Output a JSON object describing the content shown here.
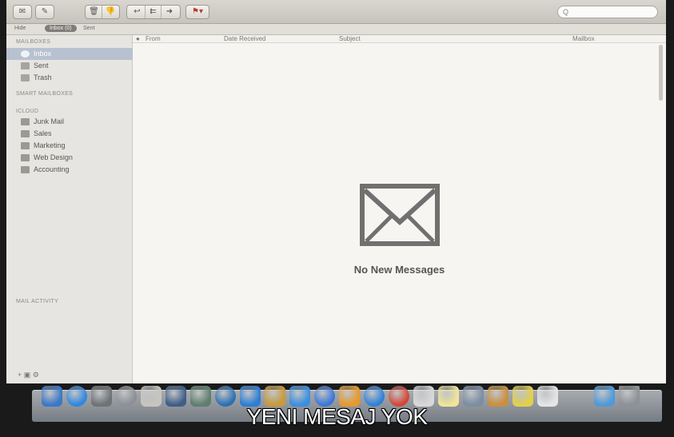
{
  "favorites": {
    "hide": "Hide",
    "inbox": "Inbox (0)",
    "sent": "Sent"
  },
  "search": {
    "placeholder": "Q"
  },
  "sidebar": {
    "mailboxes_header": "MAILBOXES",
    "mailboxes": [
      {
        "label": "Inbox",
        "icon": "inbox-icon"
      },
      {
        "label": "Sent",
        "icon": "sent-icon"
      },
      {
        "label": "Trash",
        "icon": "trash-icon"
      }
    ],
    "smart_header": "SMART MAILBOXES",
    "icloud_header": "ICLOUD",
    "icloud": [
      {
        "label": "Junk Mail",
        "icon": "folder-icon"
      },
      {
        "label": "Sales",
        "icon": "folder-icon"
      },
      {
        "label": "Marketing",
        "icon": "folder-icon"
      },
      {
        "label": "Web Design",
        "icon": "folder-icon"
      },
      {
        "label": "Accounting",
        "icon": "folder-icon"
      }
    ],
    "activity_header": "MAIL ACTIVITY",
    "bottom_controls": "+  ▣  ⚙"
  },
  "list_columns": {
    "dot": "●",
    "from": "From",
    "date": "Date Received",
    "subject": "Subject",
    "mailbox": "Mailbox"
  },
  "empty_state": {
    "message": "No New Messages",
    "icon": "envelope-icon"
  },
  "dock": {
    "icons": [
      {
        "name": "finder-icon",
        "color": "#3b78c8"
      },
      {
        "name": "app-store-icon",
        "color": "#2f86e0"
      },
      {
        "name": "photo-booth-icon",
        "color": "#6f7376"
      },
      {
        "name": "launchpad-icon",
        "color": "#8c8f93"
      },
      {
        "name": "calculator-icon",
        "color": "#c7c5be"
      },
      {
        "name": "facetime-icon",
        "color": "#3f5f87"
      },
      {
        "name": "image-capture-icon",
        "color": "#5f7f6e"
      },
      {
        "name": "quicktime-icon",
        "color": "#2c6fb2"
      },
      {
        "name": "keynote-icon",
        "color": "#2d7ed5"
      },
      {
        "name": "textedit-icon",
        "color": "#c89a3c"
      },
      {
        "name": "mail-icon",
        "color": "#3b8fe0"
      },
      {
        "name": "itunes-icon",
        "color": "#3b76d8"
      },
      {
        "name": "ibooks-icon",
        "color": "#e69a2b"
      },
      {
        "name": "safari-icon",
        "color": "#2f80d8"
      },
      {
        "name": "chrome-icon",
        "color": "#d54533"
      },
      {
        "name": "reminders-icon",
        "color": "#d8d8d8"
      },
      {
        "name": "notes-icon",
        "color": "#f0e59a"
      },
      {
        "name": "preview-icon",
        "color": "#7b8ea3"
      },
      {
        "name": "contacts-icon",
        "color": "#c98f3d"
      },
      {
        "name": "stickies-icon",
        "color": "#e3d04a"
      },
      {
        "name": "script-editor-icon",
        "color": "#e5e5e5"
      },
      {
        "name": "downloads-icon",
        "color": "#4f9ad9"
      },
      {
        "name": "trash-icon",
        "color": "#8e9296"
      }
    ]
  },
  "caption": "YENI MESAJ YOK"
}
